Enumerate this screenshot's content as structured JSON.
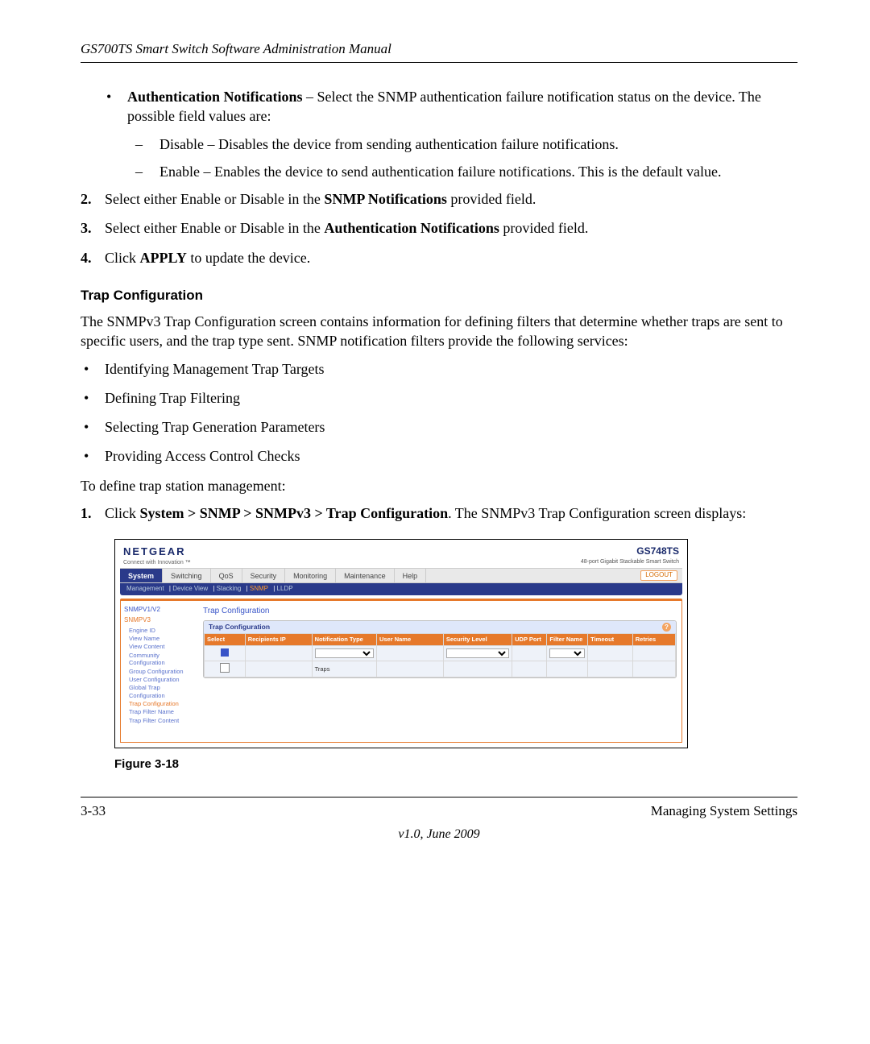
{
  "header": {
    "running": "GS700TS Smart Switch Software Administration Manual"
  },
  "bullet1": {
    "title": "Authentication Notifications",
    "desc": " – Select the SNMP authentication failure notification status on the device. The possible field values are:",
    "opts": {
      "disable": "Disable – Disables the device from sending authentication failure notifications.",
      "enable": "Enable – Enables the device to send authentication failure notifications. This is the default value."
    }
  },
  "steps_a": {
    "s2_pre": "Select either Enable or Disable in the ",
    "s2_bold": "SNMP Notifications",
    "s2_post": " provided field.",
    "s3_pre": "Select either Enable or Disable in the ",
    "s3_bold": "Authentication Notifications",
    "s3_post": " provided field.",
    "s4_pre": "Click ",
    "s4_bold": "APPLY",
    "s4_post": " to update the device."
  },
  "trap_section": {
    "heading": "Trap Configuration",
    "intro": "The SNMPv3 Trap Configuration screen contains information for defining filters that determine whether traps are sent to specific users, and the trap type sent. SNMP notification filters provide the following services:",
    "services": [
      "Identifying Management Trap Targets",
      "Defining Trap Filtering",
      "Selecting Trap Generation Parameters",
      "Providing Access Control Checks"
    ],
    "lead_in": "To define trap station management:",
    "step1_pre": "Click ",
    "step1_bold": "System > SNMP > SNMPv3 > Trap Configuration",
    "step1_post": ". The SNMPv3 Trap Configuration screen displays:"
  },
  "figure": {
    "caption": "Figure 3-18",
    "brand": "NETGEAR",
    "brand_sub": "Connect with Innovation ™",
    "model": "GS748TS",
    "model_desc": "48-port Gigabit Stackable Smart Switch",
    "tabs": [
      "System",
      "Switching",
      "QoS",
      "Security",
      "Monitoring",
      "Maintenance",
      "Help"
    ],
    "logout": "LOGOUT",
    "subnav": [
      "Management",
      "Device View",
      "Stacking",
      "SNMP",
      "LLDP"
    ],
    "subnav_active": "SNMP",
    "side_cats": [
      "SNMPV1/V2",
      "SNMPV3"
    ],
    "side_items": [
      "Engine ID",
      "View Name",
      "View Content",
      "Community Configuration",
      "Group Configuration",
      "User Configuration",
      "Global Trap Configuration",
      "Trap Configuration",
      "Trap Filter Name",
      "Trap Filter Content"
    ],
    "side_active": "Trap Configuration",
    "main_title": "Trap Configuration",
    "panel_title": "Trap Configuration",
    "cols": [
      "Select",
      "Recipients IP",
      "Notification Type",
      "User Name",
      "Security Level",
      "UDP Port",
      "Filter Name",
      "Timeout",
      "Retries"
    ],
    "row2_cell": "Traps"
  },
  "footer": {
    "page": "3-33",
    "section": "Managing System Settings",
    "version": "v1.0, June 2009"
  }
}
